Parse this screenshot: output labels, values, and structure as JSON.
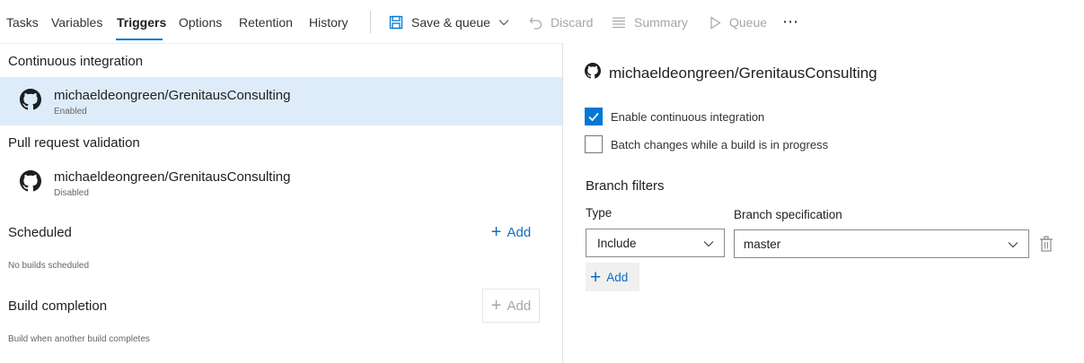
{
  "tabs": [
    {
      "label": "Tasks",
      "active": false
    },
    {
      "label": "Variables",
      "active": false
    },
    {
      "label": "Triggers",
      "active": true
    },
    {
      "label": "Options",
      "active": false
    },
    {
      "label": "Retention",
      "active": false
    },
    {
      "label": "History",
      "active": false
    }
  ],
  "toolbar": {
    "save_queue": "Save & queue",
    "discard": "Discard",
    "summary": "Summary",
    "queue": "Queue",
    "more": "⋯"
  },
  "colors": {
    "accent": "#0078d4",
    "selected_row": "#deecf9",
    "disabled_text": "#a6a6a6"
  },
  "left": {
    "ci": {
      "title": "Continuous integration",
      "repo": "michaeldeongreen/GrenitausConsulting",
      "status": "Enabled",
      "icon": "github-icon"
    },
    "pr": {
      "title": "Pull request validation",
      "repo": "michaeldeongreen/GrenitausConsulting",
      "status": "Disabled",
      "icon": "github-icon"
    },
    "scheduled": {
      "title": "Scheduled",
      "add_label": "Add",
      "note": "No builds scheduled"
    },
    "build_completion": {
      "title": "Build completion",
      "add_label": "Add",
      "note": "Build when another build completes"
    }
  },
  "detail": {
    "title": "michaeldeongreen/GrenitausConsulting",
    "enable_ci": {
      "label": "Enable continuous integration",
      "checked": true
    },
    "batch_changes": {
      "label": "Batch changes while a build is in progress",
      "checked": false
    },
    "branch_filters": {
      "heading": "Branch filters",
      "type_label": "Type",
      "spec_label": "Branch specification",
      "type_value": "Include",
      "spec_value": "master",
      "add_label": "Add"
    }
  }
}
